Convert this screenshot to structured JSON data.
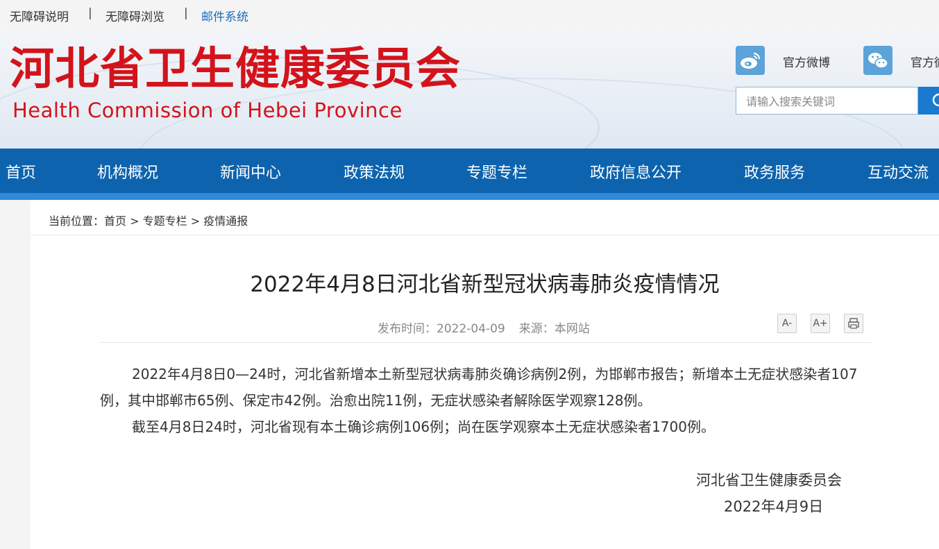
{
  "topbar": {
    "links": [
      "无障碍说明",
      "无障碍浏览",
      "邮件系统"
    ],
    "separator": "|"
  },
  "header": {
    "logo_cn": "河北省卫生健康委员会",
    "logo_en": "Health Commission of Hebei Province",
    "social": [
      {
        "label": "官方微博",
        "icon": "weibo-icon"
      },
      {
        "label": "官方微",
        "icon": "wechat-icon"
      }
    ],
    "search": {
      "placeholder": "请输入搜索关键词",
      "icon": "search-icon"
    }
  },
  "nav": {
    "items": [
      "首页",
      "机构概况",
      "新闻中心",
      "政策法规",
      "专题专栏",
      "政府信息公开",
      "政务服务",
      "互动交流"
    ]
  },
  "breadcrumb": {
    "prefix": "当前位置：",
    "items": [
      "首页",
      "专题专栏",
      "疫情通报"
    ],
    "separator": " > "
  },
  "article": {
    "title": "2022年4月8日河北省新型冠状病毒肺炎疫情情况",
    "publish_time": "发布时间：2022-04-09",
    "source": "来源：本网站",
    "tools": {
      "font_smaller": "A-",
      "font_larger": "A+",
      "print_icon": "printer-icon"
    },
    "paragraphs": [
      "2022年4月8日0—24时，河北省新增本土新型冠状病毒肺炎确诊病例2例，为邯郸市报告；新增本土无症状感染者107例，其中邯郸市65例、保定市42例。治愈出院11例，无症状感染者解除医学观察128例。",
      "截至4月8日24时，河北省现有本土确诊病例106例；尚在医学观察本土无症状感染者1700例。"
    ],
    "signature_org": "河北省卫生健康委员会",
    "signature_date": "2022年4月9日"
  },
  "colors": {
    "brand_red": "#d3131b",
    "nav_blue": "#0d63ae",
    "link_blue": "#1c6db4"
  }
}
